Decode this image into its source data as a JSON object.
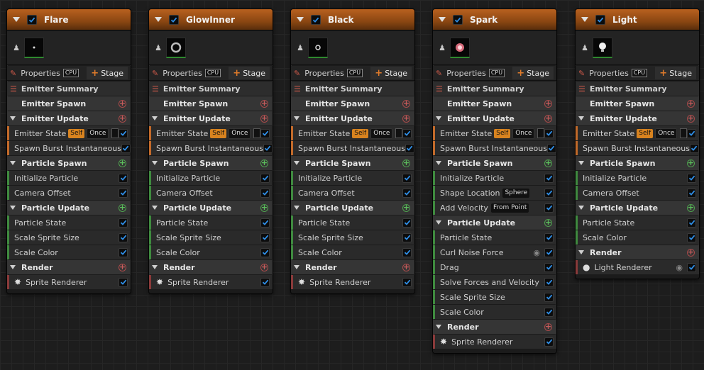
{
  "labels": {
    "properties": "Properties",
    "cpu": "CPU",
    "stage": "Stage",
    "emitter_summary": "Emitter Summary",
    "emitter_spawn": "Emitter Spawn",
    "emitter_update": "Emitter Update",
    "particle_spawn": "Particle Spawn",
    "particle_update": "Particle Update",
    "render": "Render",
    "self": "Self",
    "once": "Once"
  },
  "emitters": [
    {
      "name": "Flare",
      "thumb": "flare-dot",
      "emitter_update": [
        "Emitter State",
        "Spawn Burst Instantaneous"
      ],
      "particle_spawn": [
        {
          "label": "Initialize Particle"
        },
        {
          "label": "Camera Offset"
        }
      ],
      "particle_update": [
        {
          "label": "Particle State"
        },
        {
          "label": "Scale Sprite Size"
        },
        {
          "label": "Scale Color"
        }
      ],
      "render": {
        "label": "Sprite Renderer",
        "icon": "sprite-icon",
        "eye": false
      }
    },
    {
      "name": "GlowInner",
      "thumb": "glow-ring",
      "emitter_update": [
        "Emitter State",
        "Spawn Burst Instantaneous"
      ],
      "particle_spawn": [
        {
          "label": "Initialize Particle"
        },
        {
          "label": "Camera Offset"
        }
      ],
      "particle_update": [
        {
          "label": "Particle State"
        },
        {
          "label": "Scale Sprite Size"
        },
        {
          "label": "Scale Color"
        }
      ],
      "render": {
        "label": "Sprite Renderer",
        "icon": "sprite-icon",
        "eye": false
      }
    },
    {
      "name": "Black",
      "thumb": "black-ring",
      "emitter_update": [
        "Emitter State",
        "Spawn Burst Instantaneous"
      ],
      "particle_spawn": [
        {
          "label": "Initialize Particle"
        },
        {
          "label": "Camera Offset"
        }
      ],
      "particle_update": [
        {
          "label": "Particle State"
        },
        {
          "label": "Scale Sprite Size"
        },
        {
          "label": "Scale Color"
        }
      ],
      "render": {
        "label": "Sprite Renderer",
        "icon": "sprite-icon",
        "eye": false
      }
    },
    {
      "name": "Spark",
      "thumb": "spark-glow",
      "emitter_update": [
        "Emitter State",
        "Spawn Burst Instantaneous"
      ],
      "particle_spawn": [
        {
          "label": "Initialize Particle"
        },
        {
          "label": "Shape Location",
          "tag": "Sphere"
        },
        {
          "label": "Add Velocity",
          "tag": "From Point"
        }
      ],
      "particle_update": [
        {
          "label": "Particle State"
        },
        {
          "label": "Curl Noise Force",
          "eye": true
        },
        {
          "label": "Drag"
        },
        {
          "label": "Solve Forces and Velocity"
        },
        {
          "label": "Scale Sprite Size"
        },
        {
          "label": "Scale Color"
        }
      ],
      "render": {
        "label": "Sprite Renderer",
        "icon": "sprite-icon",
        "eye": false
      }
    },
    {
      "name": "Light",
      "thumb": "light-bulb",
      "emitter_update": [
        "Emitter State",
        "Spawn Burst Instantaneous"
      ],
      "particle_spawn": [
        {
          "label": "Initialize Particle"
        },
        {
          "label": "Camera Offset"
        }
      ],
      "particle_update": [
        {
          "label": "Particle State"
        },
        {
          "label": "Scale Color"
        }
      ],
      "render": {
        "label": "Light Renderer",
        "icon": "bulb-icon",
        "eye": true
      }
    }
  ],
  "colors": {
    "header": "#8a4612",
    "check": "#2f8fe8",
    "stage_plus": "#e07b2a"
  }
}
